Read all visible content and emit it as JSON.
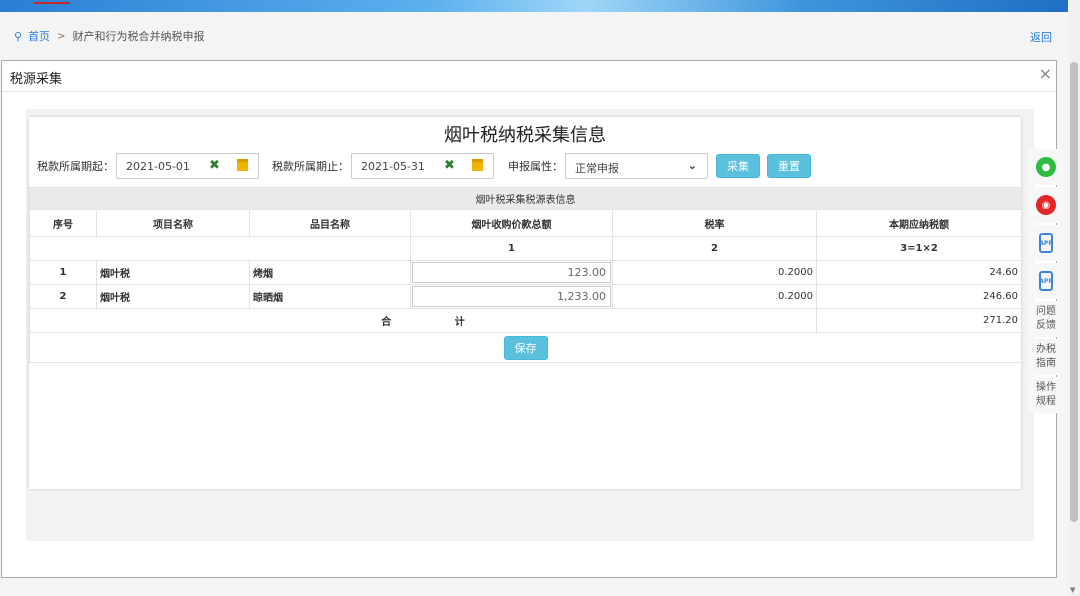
{
  "breadcrumb": {
    "home": "首页",
    "separator": ">",
    "current": "财产和行为税合并纳税申报"
  },
  "back_label": "返回",
  "modal": {
    "title": "税源采集",
    "close": "×"
  },
  "form": {
    "title": "烟叶税纳税采集信息",
    "start_label": "税款所属期起：",
    "start_value": "2021-05-01",
    "end_label": "税款所属期止：",
    "end_value": "2021-05-31",
    "clear_icon": "✖",
    "attr_label": "申报属性：",
    "attr_value": "正常申报",
    "collect_button": "采集",
    "reset_button": "重置"
  },
  "table": {
    "caption": "烟叶税采集税源表信息",
    "headers": [
      "序号",
      "项目名称",
      "品目名称",
      "烟叶收购价款总额",
      "税率",
      "本期应纳税额"
    ],
    "index_row": [
      "1",
      "2",
      "3=1×2"
    ],
    "rows": [
      {
        "no": "1",
        "project": "烟叶税",
        "item": "烤烟",
        "amount": "123.00",
        "rate": "0.2000",
        "tax": "24.60"
      },
      {
        "no": "2",
        "project": "烟叶税",
        "item": "晾晒烟",
        "amount": "1,233.00",
        "rate": "0.2000",
        "tax": "246.60"
      }
    ],
    "total_label": "合 计",
    "total_tax": "271.20",
    "save_button": "保存"
  },
  "sidebar": {
    "wechat_icon": "wechat-icon",
    "weibo_icon": "weibo-icon",
    "app_label": "APP",
    "feedback": "问题反馈",
    "guide": "办税指南",
    "procedure": "操作规程"
  },
  "colors": {
    "accent": "#2b7fd6",
    "button": "#5bc0de",
    "wechat": "#2dbd43",
    "weibo": "#e4262b"
  }
}
